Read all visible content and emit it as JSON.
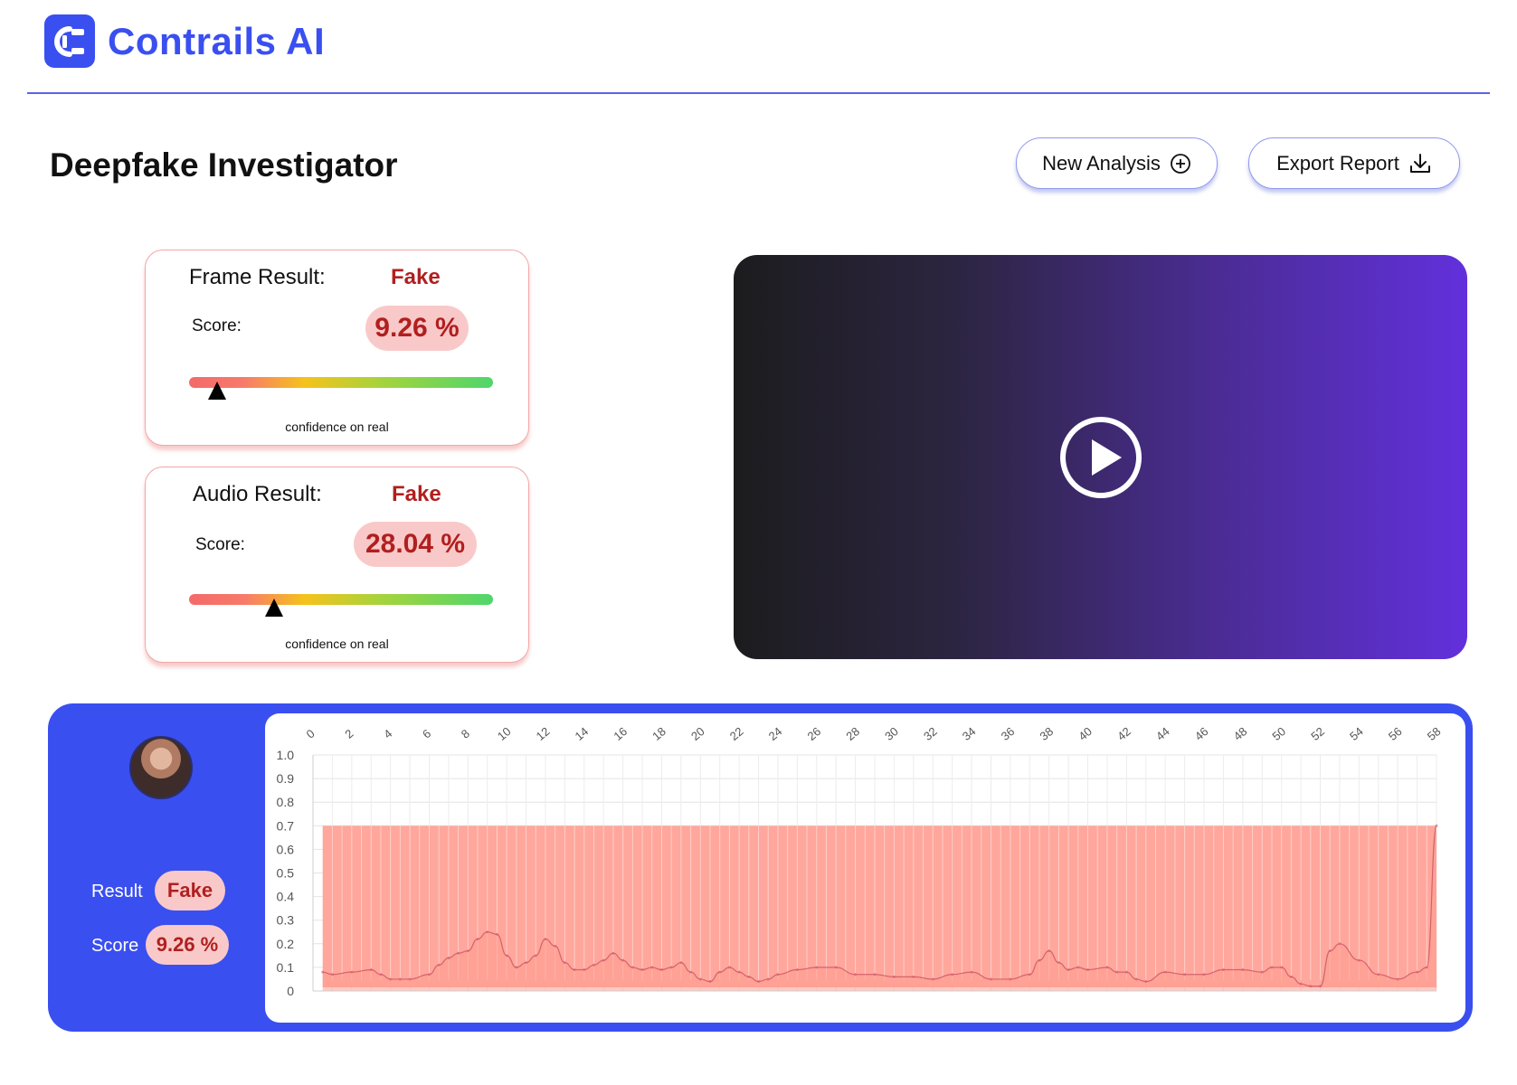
{
  "brand": {
    "name": "Contrails AI",
    "accent": "#3a4ff0"
  },
  "page": {
    "title": "Deepfake Investigator"
  },
  "actions": {
    "new_analysis": "New Analysis",
    "export_report": "Export Report"
  },
  "frame_card": {
    "title": "Frame Result:",
    "result": "Fake",
    "score_label": "Score:",
    "score": "9.26 %",
    "gauge_value": 0.0926,
    "caption": "confidence on real"
  },
  "audio_card": {
    "title": "Audio Result:",
    "result": "Fake",
    "score_label": "Score:",
    "score": "28.04 %",
    "gauge_value": 0.2804,
    "caption": "confidence on real"
  },
  "video": {
    "icon": "play-circle-icon"
  },
  "timeline": {
    "result_label": "Result",
    "result": "Fake",
    "score_label": "Score",
    "score": "9.26 %"
  },
  "chart_data": {
    "type": "area",
    "title": "",
    "xlabel": "",
    "ylabel": "",
    "xlim": [
      0,
      58
    ],
    "ylim": [
      0,
      1.0
    ],
    "x_ticks": [
      0,
      2,
      4,
      6,
      8,
      10,
      12,
      14,
      16,
      18,
      20,
      22,
      24,
      26,
      28,
      30,
      32,
      34,
      36,
      38,
      40,
      42,
      44,
      46,
      48,
      50,
      52,
      54,
      56,
      58
    ],
    "y_ticks": [
      "0",
      "0.1",
      "0.2",
      "0.3",
      "0.4",
      "0.5",
      "0.6",
      "0.7",
      "0.8",
      "0.9",
      "1.0"
    ],
    "grid": true,
    "fill_color": "#ff9c8f",
    "band_color": "#ffa79c",
    "band_range": [
      0.5,
      58
    ],
    "band_top": 0.7,
    "series": [
      {
        "x": [
          0.5,
          1,
          2,
          3,
          3.5,
          4,
          4.5,
          5,
          6,
          6.5,
          7,
          7.5,
          8,
          8.5,
          9,
          9.5,
          10,
          10.5,
          11,
          11.5,
          12,
          12.5,
          13,
          13.5,
          14,
          14.5,
          15,
          15.5,
          16,
          16.5,
          17,
          17.5,
          18,
          18.5,
          19,
          19.5,
          20,
          20.5,
          21,
          21.5,
          22,
          22.5,
          23,
          23.5,
          24,
          25,
          26,
          27,
          28,
          29,
          30,
          31,
          32,
          33,
          34,
          35,
          36,
          37,
          37.5,
          38,
          38.5,
          39,
          39.5,
          40,
          41,
          41.5,
          42,
          42.5,
          43,
          44,
          45,
          46,
          47,
          48,
          49,
          49.5,
          50,
          50.5,
          51,
          51.5,
          52,
          52.5,
          53,
          54,
          55,
          56,
          57,
          57.5,
          58
        ],
        "y": [
          0.08,
          0.07,
          0.08,
          0.09,
          0.07,
          0.05,
          0.05,
          0.05,
          0.07,
          0.11,
          0.14,
          0.16,
          0.17,
          0.22,
          0.25,
          0.24,
          0.15,
          0.1,
          0.12,
          0.15,
          0.22,
          0.19,
          0.12,
          0.09,
          0.09,
          0.11,
          0.13,
          0.16,
          0.13,
          0.1,
          0.09,
          0.1,
          0.09,
          0.1,
          0.12,
          0.08,
          0.05,
          0.04,
          0.08,
          0.1,
          0.08,
          0.06,
          0.04,
          0.05,
          0.07,
          0.09,
          0.1,
          0.1,
          0.07,
          0.07,
          0.06,
          0.06,
          0.05,
          0.07,
          0.08,
          0.05,
          0.05,
          0.07,
          0.13,
          0.17,
          0.12,
          0.09,
          0.1,
          0.09,
          0.1,
          0.08,
          0.08,
          0.05,
          0.04,
          0.08,
          0.07,
          0.07,
          0.09,
          0.09,
          0.08,
          0.1,
          0.1,
          0.06,
          0.03,
          0.02,
          0.02,
          0.17,
          0.2,
          0.13,
          0.07,
          0.05,
          0.08,
          0.1,
          0.7
        ]
      }
    ]
  }
}
